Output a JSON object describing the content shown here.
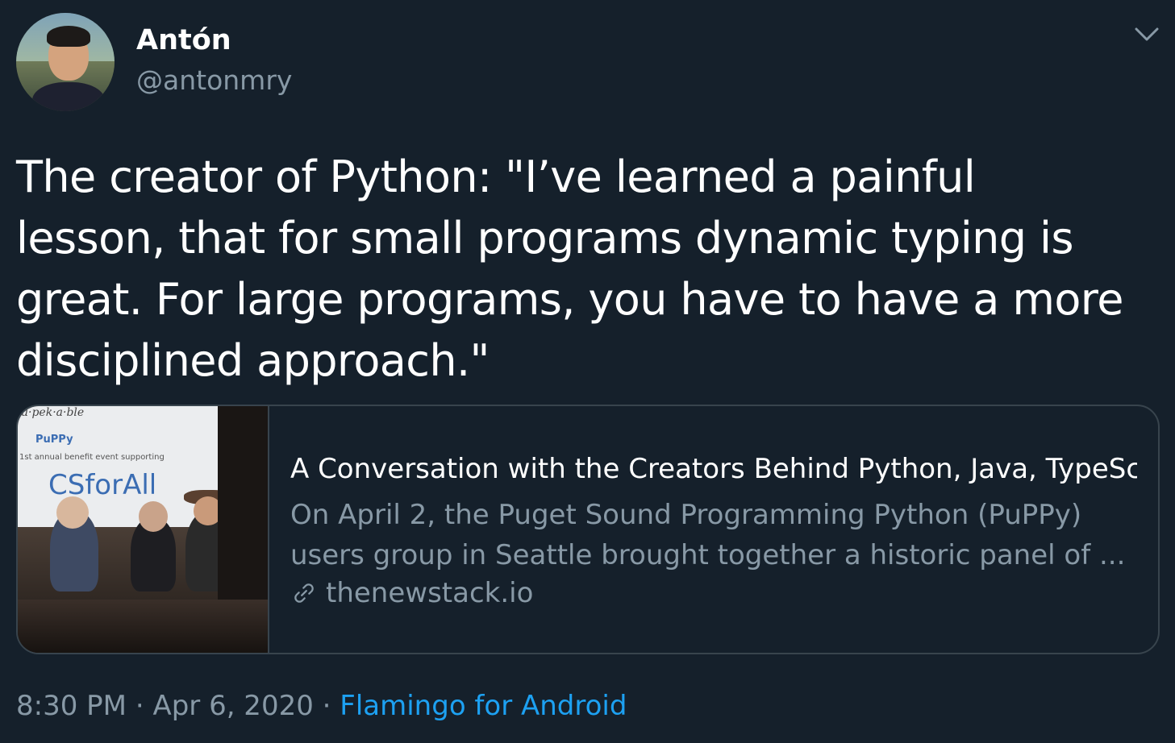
{
  "author": {
    "display_name": "Antón",
    "handle": "@antonmry"
  },
  "tweet": {
    "text": "The creator of Python: \"I’ve learned a painful lesson, that for small programs dynamic typing is great. For large programs, you have to have a more disciplined approach.\""
  },
  "card": {
    "image_texts": {
      "banner_top": "u·pek·a·ble",
      "puppy": "PuPPy",
      "event": "1st annual benefit event supporting",
      "csforall": "CSforAll"
    },
    "title": "A Conversation with the Creators Behind Python, Java, TypeSc...",
    "description": "On April 2, the Puget Sound Programming Python (PuPPy) users group in Seattle brought together a historic panel of ...",
    "domain": "thenewstack.io"
  },
  "meta": {
    "time": "8:30 PM",
    "separator": "·",
    "date": "Apr 6, 2020",
    "source": "Flamingo for Android"
  },
  "icons": {
    "chevron": "chevron-down-icon",
    "link": "link-icon"
  },
  "colors": {
    "background": "#15202b",
    "secondary_text": "#8899a6",
    "accent": "#1da1f2",
    "border": "#38444d"
  }
}
